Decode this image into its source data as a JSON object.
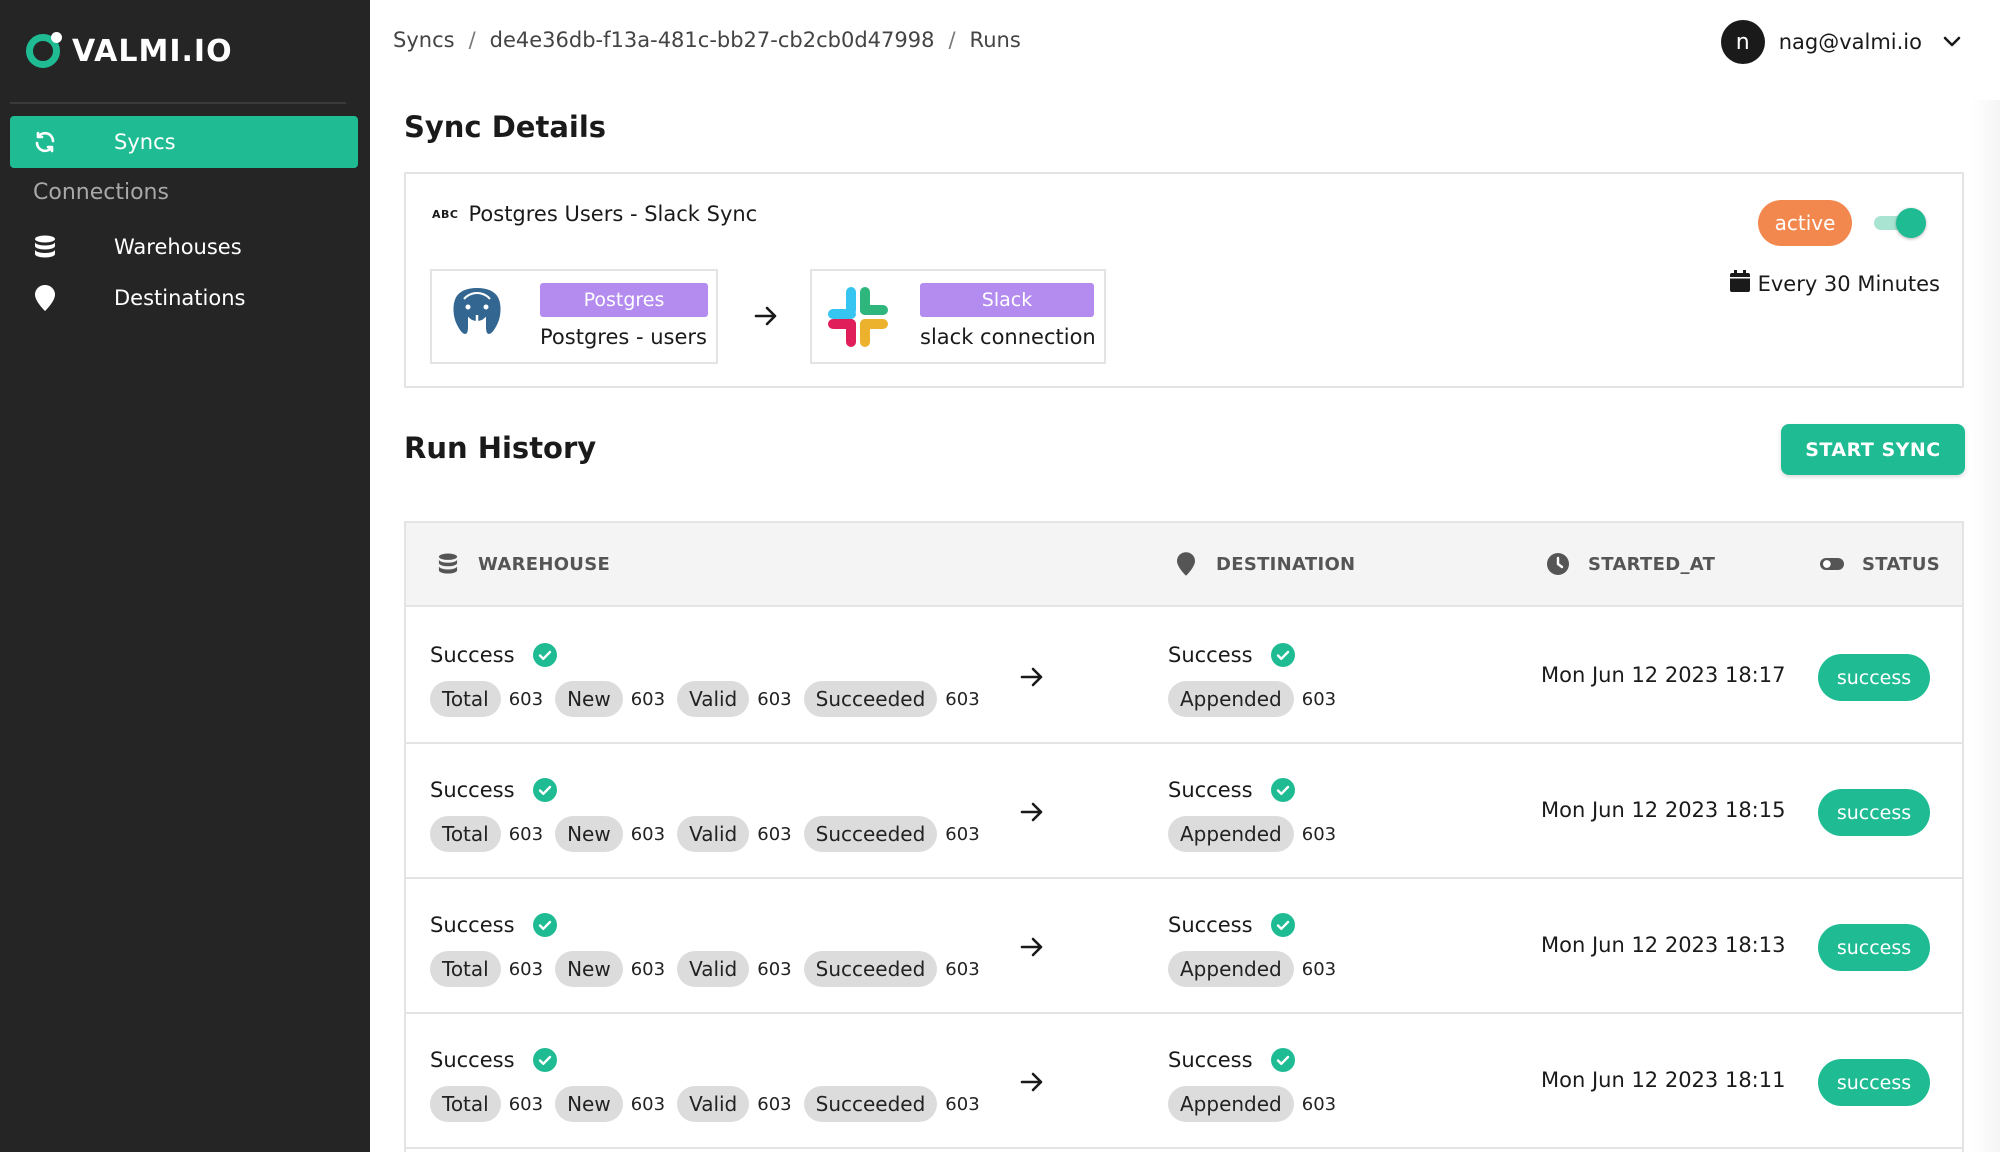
{
  "app": {
    "logo_text": "VALMI.IO"
  },
  "sidebar": {
    "syncs_label": "Syncs",
    "connections_heading": "Connections",
    "warehouses_label": "Warehouses",
    "destinations_label": "Destinations"
  },
  "breadcrumb": {
    "root": "Syncs",
    "sep": "/",
    "sync_id": "de4e36db-f13a-481c-bb27-cb2cb0d47998",
    "current": "Runs"
  },
  "user": {
    "avatar_letter": "n",
    "email": "nag@valmi.io"
  },
  "sync_details": {
    "heading": "Sync Details",
    "abc_icon_text": "ABC",
    "name": "Postgres Users - Slack Sync",
    "source": {
      "badge": "Postgres",
      "name": "Postgres - users"
    },
    "destination": {
      "badge": "Slack",
      "name": "slack connection"
    },
    "status": "active",
    "toggle_on": true,
    "schedule": "Every 30 Minutes"
  },
  "run_history": {
    "heading": "Run History",
    "start_button": "START SYNC",
    "columns": {
      "warehouse": "WAREHOUSE",
      "destination": "DESTINATION",
      "started_at": "STARTED_AT",
      "status": "STATUS"
    },
    "rows": [
      {
        "wh_status": "Success",
        "total_label": "Total",
        "total": "603",
        "new_label": "New",
        "new": "603",
        "valid_label": "Valid",
        "valid": "603",
        "succeeded_label": "Succeeded",
        "succeeded": "603",
        "dest_status": "Success",
        "appended_label": "Appended",
        "appended": "603",
        "started_at": "Mon Jun 12 2023 18:17",
        "status": "success"
      },
      {
        "wh_status": "Success",
        "total_label": "Total",
        "total": "603",
        "new_label": "New",
        "new": "603",
        "valid_label": "Valid",
        "valid": "603",
        "succeeded_label": "Succeeded",
        "succeeded": "603",
        "dest_status": "Success",
        "appended_label": "Appended",
        "appended": "603",
        "started_at": "Mon Jun 12 2023 18:15",
        "status": "success"
      },
      {
        "wh_status": "Success",
        "total_label": "Total",
        "total": "603",
        "new_label": "New",
        "new": "603",
        "valid_label": "Valid",
        "valid": "603",
        "succeeded_label": "Succeeded",
        "succeeded": "603",
        "dest_status": "Success",
        "appended_label": "Appended",
        "appended": "603",
        "started_at": "Mon Jun 12 2023 18:13",
        "status": "success"
      },
      {
        "wh_status": "Success",
        "total_label": "Total",
        "total": "603",
        "new_label": "New",
        "new": "603",
        "valid_label": "Valid",
        "valid": "603",
        "succeeded_label": "Succeeded",
        "succeeded": "603",
        "dest_status": "Success",
        "appended_label": "Appended",
        "appended": "603",
        "started_at": "Mon Jun 12 2023 18:11",
        "status": "success"
      }
    ]
  },
  "colors": {
    "accent": "#1fbc94",
    "sidebar_bg": "#252525",
    "active_badge": "#f3884e",
    "connector_badge": "#b48cf0"
  },
  "icons": {
    "syncs": "refresh-icon",
    "warehouses": "database-icon",
    "destinations": "map-pin-icon",
    "started_at": "clock-icon",
    "status": "toggle-icon",
    "schedule": "calendar-icon",
    "check": "check-circle-icon"
  }
}
